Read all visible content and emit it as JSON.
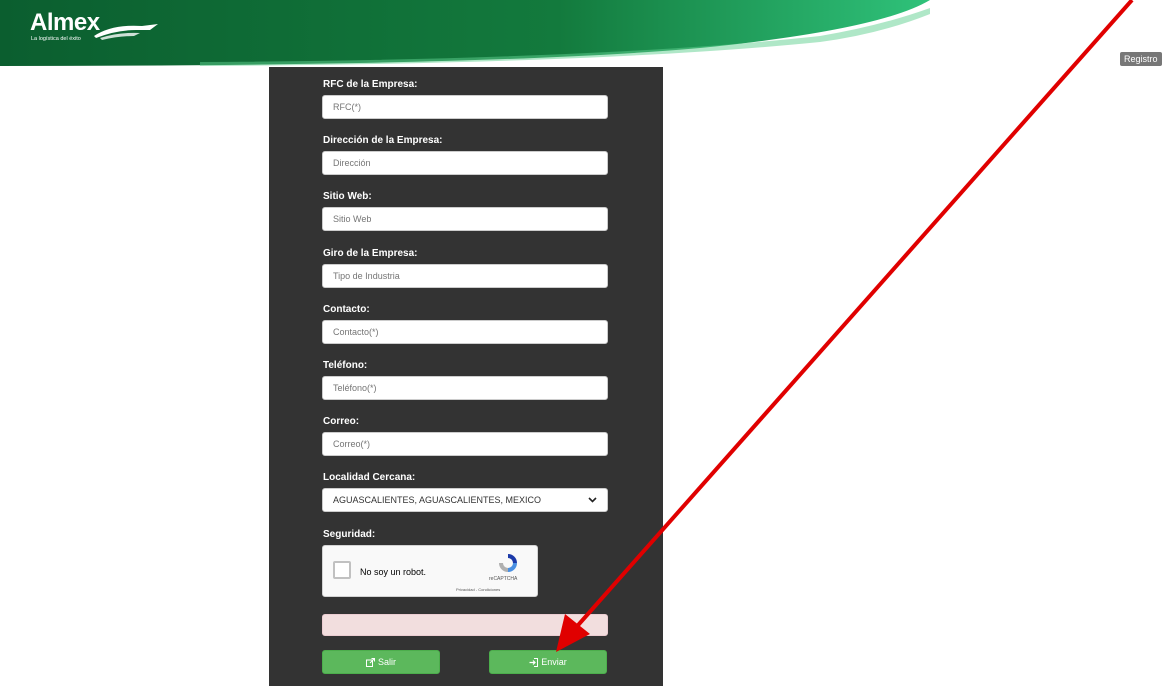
{
  "header": {
    "logo_text": "Almex",
    "logo_tagline": "La logística del éxito",
    "registro_label": "Registro",
    "colors": {
      "green_dark": "#0b5e2f",
      "green_light": "#2fc27a"
    }
  },
  "form": {
    "fields": [
      {
        "label": "RFC de la Empresa:",
        "placeholder": "RFC(*)"
      },
      {
        "label": "Dirección de la Empresa:",
        "placeholder": "Dirección"
      },
      {
        "label": "Sitio Web:",
        "placeholder": "Sitio Web"
      },
      {
        "label": "Giro de la Empresa:",
        "placeholder": "Tipo de Industria"
      },
      {
        "label": "Contacto:",
        "placeholder": "Contacto(*)"
      },
      {
        "label": "Teléfono:",
        "placeholder": "Teléfono(*)"
      },
      {
        "label": "Correo:",
        "placeholder": "Correo(*)"
      }
    ],
    "locality": {
      "label": "Localidad Cercana:",
      "selected": "AGUASCALIENTES, AGUASCALIENTES, MEXICO"
    },
    "security": {
      "label": "Seguridad:",
      "captcha_text": "No soy un robot.",
      "captcha_brand": "reCAPTCHA",
      "captcha_terms": "Privacidad - Condiciones"
    },
    "buttons": {
      "salir_label": "Salir",
      "enviar_label": "Enviar"
    }
  },
  "annotation": {
    "color": "#e00000",
    "icon": "red-arrow-pointer"
  }
}
